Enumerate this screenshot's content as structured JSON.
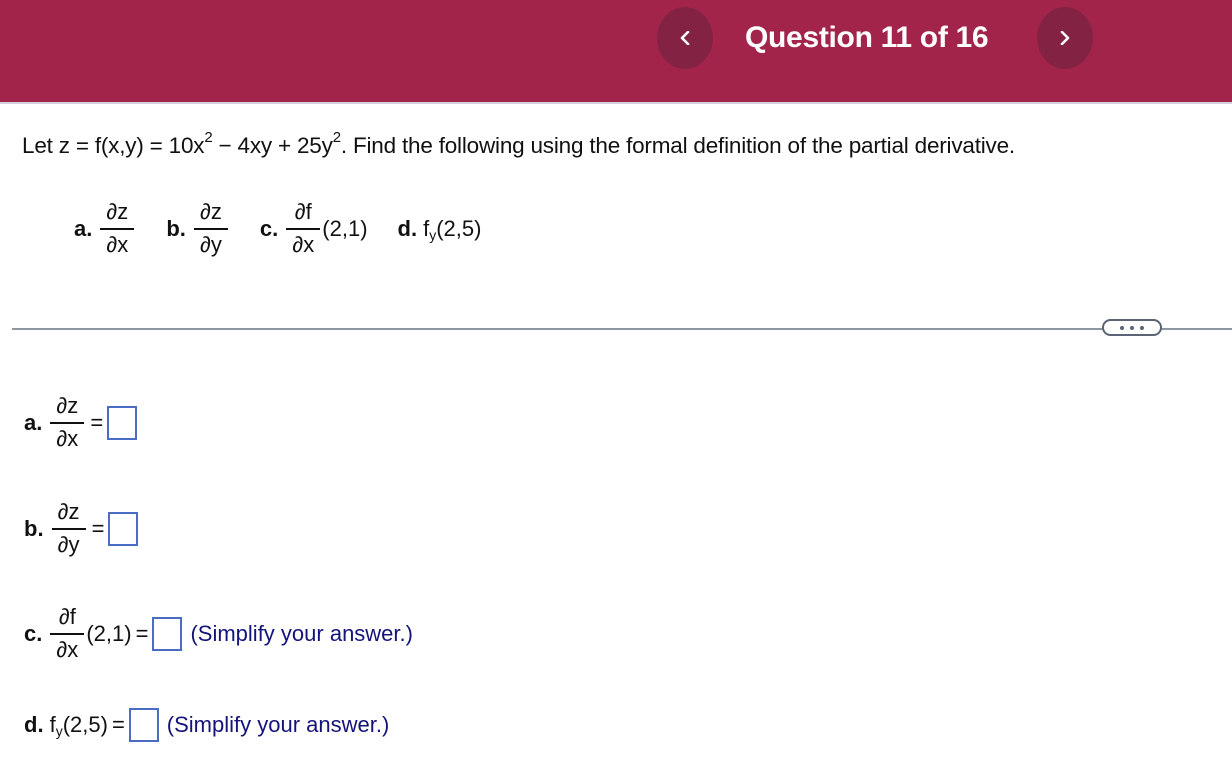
{
  "header": {
    "title": "Question 11 of 16",
    "prev_icon": "chevron-left-icon",
    "next_icon": "chevron-right-icon",
    "background_color": "#a2244b",
    "button_color": "#842244"
  },
  "prompt": {
    "lead": "Let z = f(x,y) = 10x",
    "exp1": "2",
    "mid": " − 4xy + 25y",
    "exp2": "2",
    "tail": ". Find the following using the formal definition of the partial derivative."
  },
  "parts": [
    {
      "label": "a.",
      "num": "∂z",
      "den": "∂x"
    },
    {
      "label": "b.",
      "num": "∂z",
      "den": "∂y"
    },
    {
      "label": "c.",
      "num": "∂f",
      "den": "∂x",
      "suffix": "(2,1)"
    },
    {
      "label": "d.",
      "func": "f",
      "sub": "y",
      "suffix": "(2,5)"
    }
  ],
  "more_button": {
    "icon": "ellipsis-icon"
  },
  "answers": {
    "a": {
      "label": "a.",
      "num": "∂z",
      "den": "∂x",
      "eq": "=",
      "value": ""
    },
    "b": {
      "label": "b.",
      "num": "∂z",
      "den": "∂y",
      "eq": "=",
      "value": ""
    },
    "c": {
      "label": "c.",
      "num": "∂f",
      "den": "∂x",
      "suffix": "(2,1)",
      "eq": "=",
      "value": "",
      "hint": "(Simplify your answer.)"
    },
    "d": {
      "label": "d.",
      "func": "f",
      "sub": "y",
      "suffix": "(2,5)",
      "eq": "=",
      "value": "",
      "hint": "(Simplify your answer.)"
    }
  }
}
